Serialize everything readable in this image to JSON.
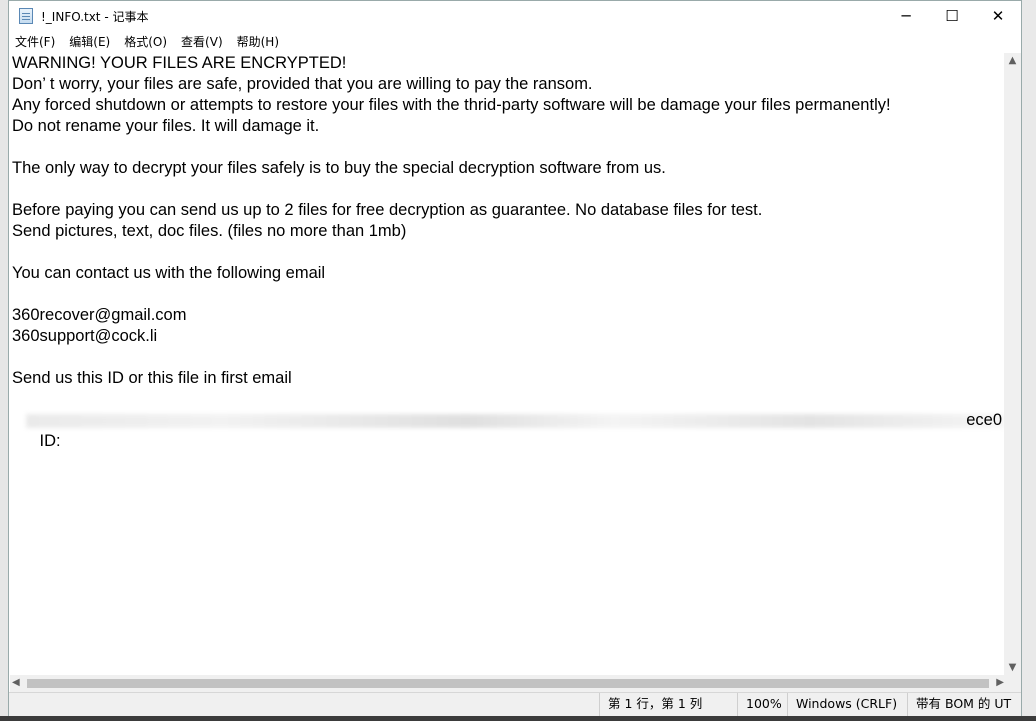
{
  "window": {
    "title": "!_INFO.txt - 记事本",
    "controls": {
      "minimize": "─",
      "maximize": "☐",
      "close": "✕"
    }
  },
  "menu": [
    "文件(F)",
    "编辑(E)",
    "格式(O)",
    "查看(V)",
    "帮助(H)"
  ],
  "content": {
    "lines": [
      "WARNING! YOUR FILES ARE ENCRYPTED!",
      "Don’ t worry, your files are safe, provided that you are willing to pay the ransom.",
      "Any forced shutdown or attempts to restore your files with the thrid-party software will be damage your files permanently!",
      "Do not rename your files. It will damage it.",
      "",
      "The only way to decrypt your files safely is to buy the special decryption software from us.",
      "",
      "Before paying you can send us up to 2 files for free decryption as guarantee. No database files for test.",
      "Send pictures, text, doc files. (files no more than 1mb)",
      "",
      "You can contact us with the following email",
      "",
      "360recover@gmail.com",
      "360support@cock.li",
      "",
      "Send us this ID or this file in first email",
      ""
    ],
    "id_prefix": "ID:",
    "id_suffix": "ece0"
  },
  "statusbar": {
    "position": "第 1 行，第 1 列",
    "zoom": "100%",
    "line_ending": "Windows (CRLF)",
    "encoding": "带有 BOM 的 UT"
  }
}
